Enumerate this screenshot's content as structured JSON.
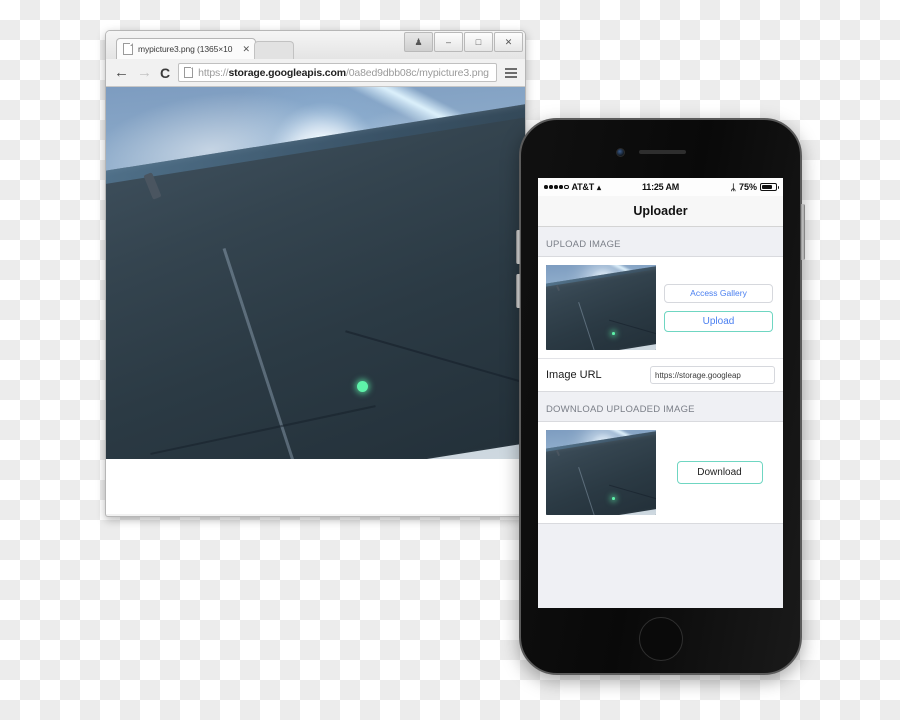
{
  "browser": {
    "window_controls": [
      {
        "name": "user-profile",
        "glyph": "♟"
      },
      {
        "name": "minimize",
        "glyph": "–"
      },
      {
        "name": "maximize",
        "glyph": "□"
      },
      {
        "name": "close",
        "glyph": "✕"
      }
    ],
    "tab": {
      "title": "mypicture3.png (1365×10",
      "close_label": "✕"
    },
    "nav": {
      "back": "←",
      "forward": "→",
      "reload": "C",
      "menu": "menu-icon"
    },
    "address": {
      "scheme": "https://",
      "host": "storage.googleapis.com",
      "path": "/0a8ed9dbb08c/mypicture3.png",
      "full": "https://storage.googleapis.com/0a8ed9dbb08c/mypicture3.png"
    }
  },
  "phone": {
    "status_bar": {
      "carrier": "AT&T",
      "wifi_icon": "▴",
      "time": "11:25 AM",
      "bluetooth_icon": "ᛦ",
      "battery_percent": "75%"
    },
    "nav_bar": {
      "title": "Uploader"
    },
    "upload_section": {
      "header": "UPLOAD IMAGE",
      "gallery_button": "Access Gallery",
      "upload_button": "Upload",
      "url_label": "Image URL",
      "url_value": "https://storage.googleap",
      "url_placeholder": "Image URL"
    },
    "download_section": {
      "header": "DOWNLOAD UPLOADED IMAGE",
      "download_button": "Download"
    }
  },
  "colors": {
    "accent_teal": "#6fd6c2",
    "link_blue": "#4a7ff0",
    "ios_bg": "#eff0f4",
    "flare_green": "#5ef2a9"
  }
}
